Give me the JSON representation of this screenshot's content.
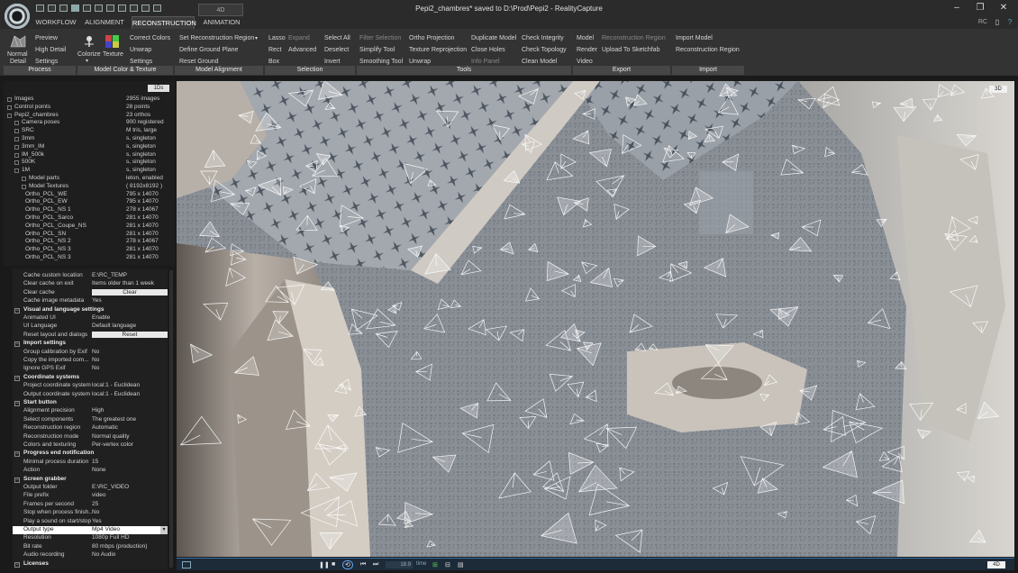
{
  "window": {
    "title": "Pepi2_chambres* saved to D:\\Prod\\Pepi2 - RealityCapture",
    "rc_label": "RC"
  },
  "tabs": [
    "WORKFLOW",
    "ALIGNMENT",
    "RECONSTRUCTION",
    "ANIMATION"
  ],
  "tab_4d": "4D",
  "ribbon": {
    "process": {
      "big_label_1": "Normal",
      "big_label_2": "Detail",
      "items": [
        "Preview",
        "High Detail",
        "Settings"
      ]
    },
    "color_texture": {
      "colorize": "Colorize",
      "texture": "Texture",
      "items": [
        "Correct Colors",
        "Unwrap",
        "Settings"
      ]
    },
    "model_alignment": {
      "items": [
        "Set Reconstruction Region",
        "Define Ground Plane",
        "Reset Ground"
      ]
    },
    "selection": {
      "col1": [
        "Lasso",
        "Rect",
        "Box"
      ],
      "col2": [
        "Expand",
        "Advanced"
      ],
      "col3": [
        "Select All",
        "Deselect",
        "Invert"
      ]
    },
    "tools": {
      "col1": [
        "Filter Selection",
        "Simplify Tool",
        "Smoothing Tool"
      ],
      "col2": [
        "Ortho Projection",
        "Texture Reprojection",
        "Unwrap"
      ],
      "col3": [
        "Duplicate Model",
        "Close Holes",
        "Info Panel"
      ],
      "col4": [
        "Check Integrity",
        "Check Topology",
        "Clean Model"
      ]
    },
    "export": {
      "col1": [
        "Model",
        "Render",
        "Video"
      ],
      "col2": [
        "Reconstruction Region",
        "Upload To Sketchfab"
      ]
    },
    "import": {
      "items": [
        "Import Model",
        "Reconstruction Region"
      ]
    },
    "groups": [
      "Process",
      "Model Color & Texture",
      "Model Alignment",
      "Selection",
      "Tools",
      "Export",
      "Import"
    ]
  },
  "tree": {
    "button_1ds": "1Ds",
    "rows": [
      {
        "name": "Images",
        "value": "2955 images"
      },
      {
        "name": "Control points",
        "value": "28 points"
      },
      {
        "name": "Pepi2_chambres",
        "value": "23 orthos"
      },
      {
        "name": "Camera poses",
        "value": "900 registered"
      },
      {
        "name": "SRC",
        "value": "M tris, large"
      },
      {
        "name": "3mm",
        "value": "s, singleton"
      },
      {
        "name": "3mm_IM",
        "value": "s, singleton"
      },
      {
        "name": "IM_500k",
        "value": "s, singleton"
      },
      {
        "name": "500K",
        "value": "s, singleton"
      },
      {
        "name": "1M",
        "value": "s, singleton"
      },
      {
        "name": "Model parts",
        "value": "leton, enabled"
      },
      {
        "name": "Model Textures",
        "value": "( 8192x8192 )"
      },
      {
        "name": "Ortho_PCL_WE",
        "value": "795 x 14070"
      },
      {
        "name": "Ortho_PCL_EW",
        "value": "795 x 14070"
      },
      {
        "name": "Ortho_PCL_NS 1",
        "value": "278 x 14067"
      },
      {
        "name": "Ortho_PCL_Sarco",
        "value": "281 x 14070"
      },
      {
        "name": "Ortho_PCL_Coupe_NS",
        "value": "281 x 14070"
      },
      {
        "name": "Ortho_PCL_SN",
        "value": "281 x 14070"
      },
      {
        "name": "Ortho_PCL_NS 2",
        "value": "278 x 14067"
      },
      {
        "name": "Ortho_PCL_NS 3",
        "value": "281 x 14070"
      },
      {
        "name": "Ortho_PCL_NS 3",
        "value": "281 x 14070"
      }
    ]
  },
  "settings": {
    "rows": [
      {
        "type": "kv",
        "k": "Cache custom location",
        "v": "E:\\RC_TEMP"
      },
      {
        "type": "kv",
        "k": "Clear cache on exit",
        "v": "Items older than 1 week"
      },
      {
        "type": "btn",
        "k": "Clear cache",
        "v": "Clear"
      },
      {
        "type": "kv",
        "k": "Cache image metadata",
        "v": "Yes"
      },
      {
        "type": "hdr",
        "k": "Visual and language settings"
      },
      {
        "type": "kv",
        "k": "Animated UI",
        "v": "Enable"
      },
      {
        "type": "kv",
        "k": "UI Language",
        "v": "Default language"
      },
      {
        "type": "btn",
        "k": "Reset layout and dialogs",
        "v": "Reset"
      },
      {
        "type": "hdr",
        "k": "Import settings"
      },
      {
        "type": "kv",
        "k": "Group calibration by Exif",
        "v": "No"
      },
      {
        "type": "kv",
        "k": "Copy the imported com...",
        "v": "No"
      },
      {
        "type": "kv",
        "k": "Ignore GPS Exif",
        "v": "No"
      },
      {
        "type": "hdr",
        "k": "Coordinate systems"
      },
      {
        "type": "kv",
        "k": "Project coordinate system",
        "v": "local:1 - Euclidean"
      },
      {
        "type": "kv",
        "k": "Output coordinate system",
        "v": "local:1 - Euclidean"
      },
      {
        "type": "hdr",
        "k": "Start button"
      },
      {
        "type": "kv",
        "k": "Alignment precision",
        "v": "High"
      },
      {
        "type": "kv",
        "k": "Select components",
        "v": "The greatest one"
      },
      {
        "type": "kv",
        "k": "Reconstruction region",
        "v": "Automatic"
      },
      {
        "type": "kv",
        "k": "Reconstruction mode",
        "v": "Normal quality"
      },
      {
        "type": "kv",
        "k": "Colors and texturing",
        "v": "Per-vertex color"
      },
      {
        "type": "hdr",
        "k": "Progress end notification"
      },
      {
        "type": "kv",
        "k": "Minimal process duration",
        "v": "15"
      },
      {
        "type": "kv",
        "k": "Action",
        "v": "None"
      },
      {
        "type": "hdr",
        "k": "Screen grabber"
      },
      {
        "type": "kv",
        "k": "Output folder",
        "v": "E:\\RC_VIDEO"
      },
      {
        "type": "kv",
        "k": "File prefix",
        "v": "video"
      },
      {
        "type": "kv",
        "k": "Frames per second",
        "v": "25"
      },
      {
        "type": "kv",
        "k": "Stop when process finish...",
        "v": "No"
      },
      {
        "type": "kv",
        "k": "Play a sound on start/stop",
        "v": "Yes"
      },
      {
        "type": "sel",
        "k": "Output type",
        "v": "Mp4 Video"
      },
      {
        "type": "kv",
        "k": "Resolution",
        "v": "1080p Full HD"
      },
      {
        "type": "kv",
        "k": "Bit rate",
        "v": "80 mbps (production)"
      },
      {
        "type": "kv",
        "k": "Audio recording",
        "v": "No Audio"
      },
      {
        "type": "hdr",
        "k": "Licenses"
      }
    ]
  },
  "viewport": {
    "badge": "3D"
  },
  "timeline": {
    "time_value": "18.9",
    "time_label": "time",
    "badge": "4D"
  }
}
